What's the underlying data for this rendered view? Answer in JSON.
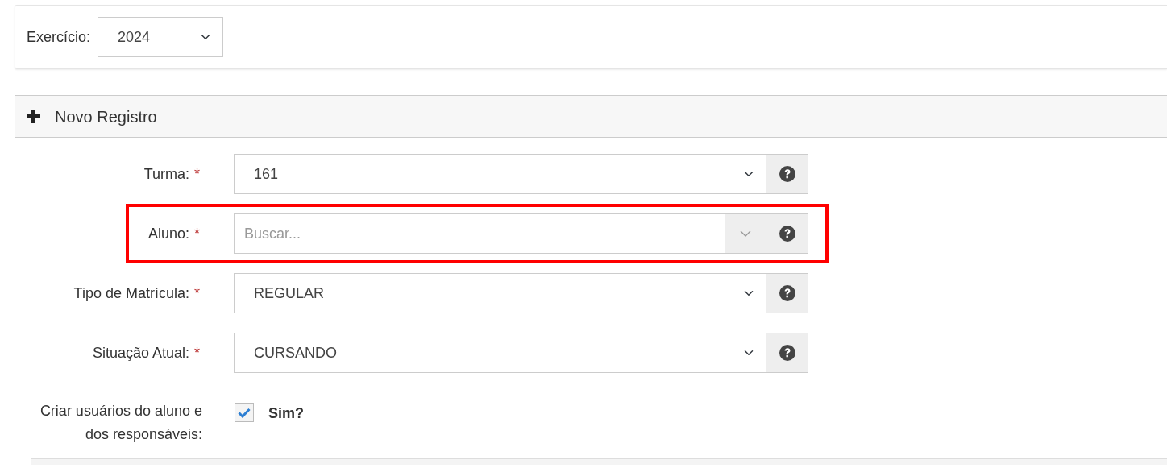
{
  "filter": {
    "label": "Exercício:",
    "value": "2024"
  },
  "panel": {
    "title": "Novo Registro",
    "fields": [
      {
        "kind": "select",
        "label": "Turma:",
        "required_mark": "*",
        "value": "161",
        "highlighted": false
      },
      {
        "kind": "search",
        "label": "Aluno:",
        "required_mark": "*",
        "placeholder": "Buscar...",
        "highlighted": true
      },
      {
        "kind": "select",
        "label": "Tipo de Matrícula:",
        "required_mark": "*",
        "value": "REGULAR",
        "highlighted": false
      },
      {
        "kind": "select",
        "label": "Situação Atual:",
        "required_mark": "*",
        "value": "CURSANDO",
        "highlighted": false
      }
    ],
    "checkbox_field": {
      "label": "Criar usuários do aluno e dos responsáveis:",
      "option": "Sim?",
      "checked": true
    }
  }
}
